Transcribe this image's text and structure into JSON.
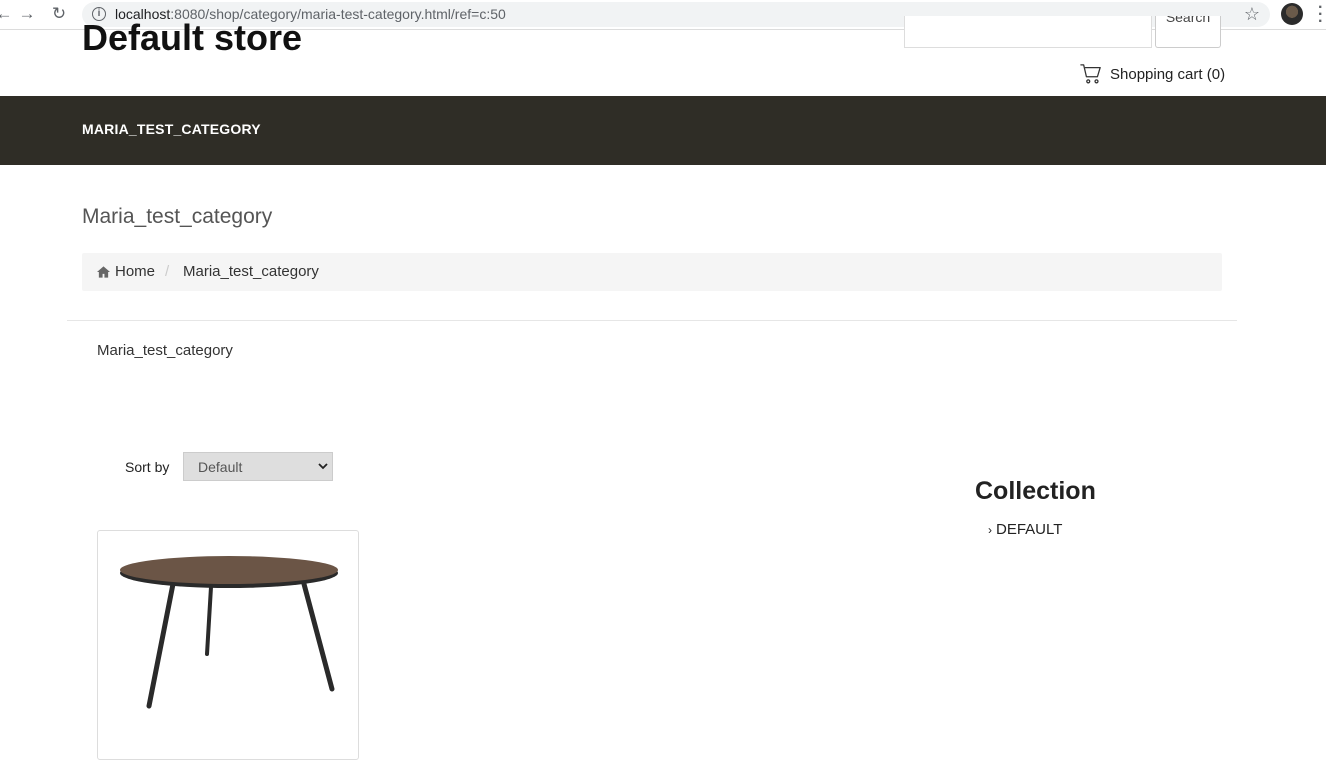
{
  "browser": {
    "url_host": "localhost",
    "url_rest": ":8080/shop/category/maria-test-category.html/ref=c:50"
  },
  "header": {
    "store_title": "Default store",
    "search_button": "Search",
    "cart_label": "Shopping cart (0)"
  },
  "navbar": {
    "items": [
      {
        "label": "MARIA_TEST_CATEGORY"
      }
    ]
  },
  "page": {
    "heading": "Maria_test_category",
    "breadcrumb": {
      "home": "Home",
      "separator": "/",
      "current": "Maria_test_category"
    },
    "category_description": "Maria_test_category"
  },
  "sort": {
    "label": "Sort by",
    "selected": "Default"
  },
  "sidebar": {
    "collection_title": "Collection",
    "items": [
      {
        "label": "DEFAULT"
      }
    ]
  },
  "colors": {
    "navbar_bg": "#2f2d26",
    "breadcrumb_bg": "#f5f5f5",
    "table_top": "#6b5546",
    "table_legs": "#2a2a2a"
  },
  "products": [
    {
      "image": "round-coffee-table"
    }
  ]
}
